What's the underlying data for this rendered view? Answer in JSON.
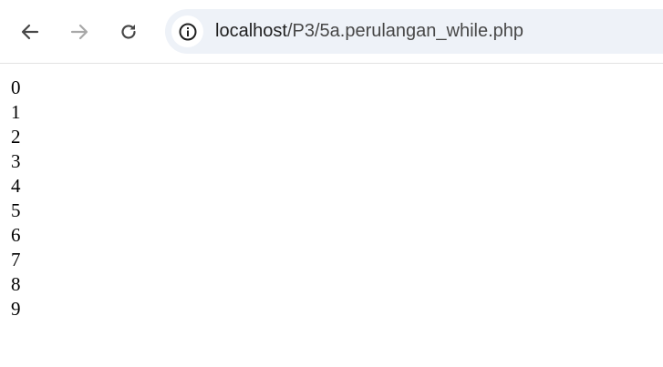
{
  "browser": {
    "url_host": "localhost",
    "url_path": "/P3/5a.perulangan_while.php"
  },
  "output": {
    "lines": [
      "0",
      "1",
      "2",
      "3",
      "4",
      "5",
      "6",
      "7",
      "8",
      "9"
    ]
  }
}
